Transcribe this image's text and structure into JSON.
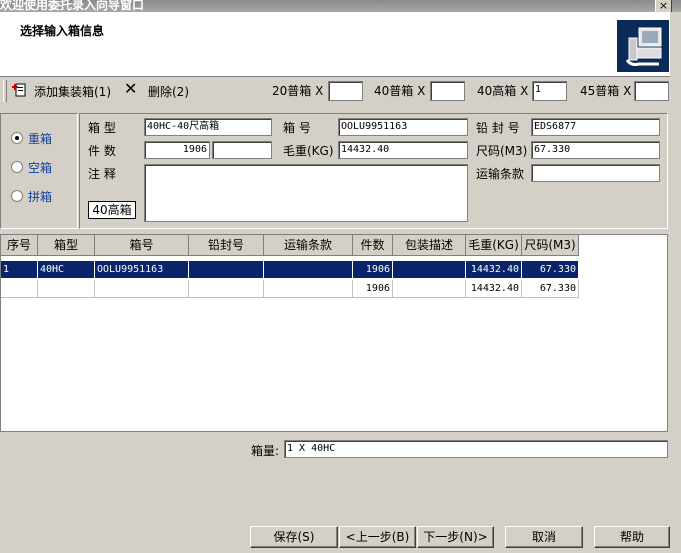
{
  "window": {
    "title": "欢迎使用委托录入向导窗口",
    "close": "×"
  },
  "header": {
    "title": "选择输入箱信息"
  },
  "toolbar": {
    "add_label": "添加集装箱(1)",
    "delete_label": "删除(2)",
    "c20_label": "20普箱 X",
    "c20_value": "",
    "c40_label": "40普箱 X",
    "c40_value": "",
    "c40h_label": "40高箱 X",
    "c40h_value": "1",
    "c45_label": "45普箱 X",
    "c45_value": ""
  },
  "radios": {
    "full": "重箱",
    "empty": "空箱",
    "lcl": "拼箱",
    "selected": "full"
  },
  "form": {
    "box_type_label": "箱    型",
    "box_type_value": "40HC-40尺高箱",
    "box_no_label": "箱    号",
    "box_no_value": "OOLU9951163",
    "seal_label": "铅 封 号",
    "seal_value": "EDS6877",
    "pieces_label": "件    数",
    "pieces_value": "1906",
    "pieces_extra": "",
    "gross_label": "毛重(KG)",
    "gross_value": "14432.40",
    "measure_label": "尺码(M3)",
    "measure_value": "67.330",
    "remark_label": "注    释",
    "remark_value": "",
    "terms_label": "运输条款",
    "terms_value": "",
    "type_tag": "40高箱"
  },
  "table": {
    "columns": [
      "序号",
      "箱型",
      "箱号",
      "铅封号",
      "运输条款",
      "件数",
      "包装描述",
      "毛重(KG)",
      "尺码(M3)"
    ],
    "rows": [
      [
        "1",
        "40HC",
        "OOLU9951163",
        "",
        "",
        "1906",
        "",
        "14432.40",
        "67.330"
      ],
      [
        "",
        "",
        "",
        "",
        "",
        "1906",
        "",
        "14432.40",
        "67.330"
      ]
    ]
  },
  "summary": {
    "label": "箱量:",
    "value": "1 X 40HC"
  },
  "buttons": {
    "save": "保存(S)",
    "prev": "<上一步(B)",
    "next": "下一步(N)>",
    "cancel": "取消",
    "help": "帮助"
  }
}
